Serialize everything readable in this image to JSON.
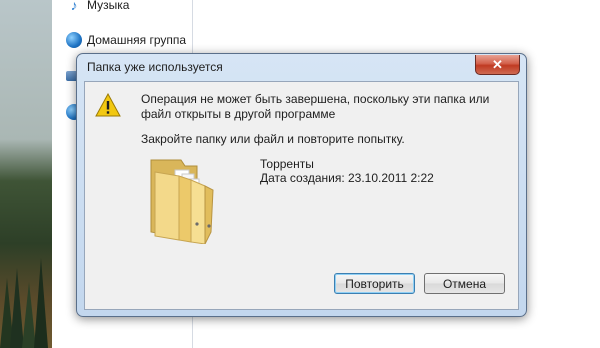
{
  "nav": {
    "items": [
      {
        "label": "Музыка",
        "icon": "music-note-icon"
      },
      {
        "label": "Домашняя группа",
        "icon": "homegroup-icon"
      }
    ]
  },
  "dialog": {
    "title": "Папка уже используется",
    "message": "Операция не может быть завершена, поскольку эти папка или файл открыты в другой программе",
    "hint": "Закройте папку или файл и повторите попытку.",
    "file_name": "Торренты",
    "file_date": "Дата создания: 23.10.2011 2:22",
    "retry_label": "Повторить",
    "cancel_label": "Отмена",
    "close_glyph": "✕"
  },
  "colors": {
    "warning": "#f2c811",
    "close_button": "#c8432c",
    "dialog_frame": "#c3d7ee"
  }
}
